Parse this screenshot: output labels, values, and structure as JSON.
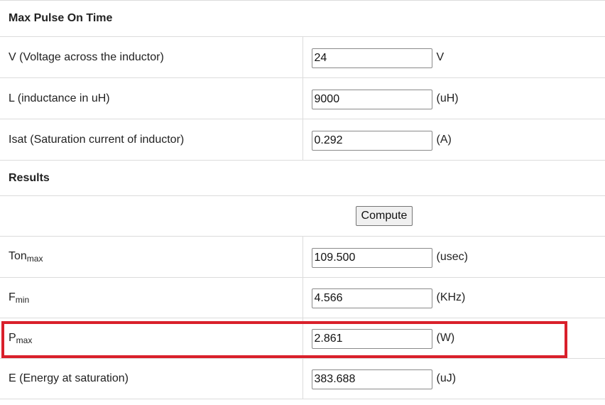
{
  "section_title": "Max Pulse On Time",
  "inputs": [
    {
      "label": "V (Voltage across the inductor)",
      "value": "24",
      "unit": "V"
    },
    {
      "label": "L (inductance in uH)",
      "value": "9000",
      "unit": "(uH)"
    },
    {
      "label": "Isat (Saturation current of inductor)",
      "value": "0.292",
      "unit": "(A)"
    }
  ],
  "results_title": "Results",
  "compute_label": "Compute",
  "results": [
    {
      "label_main": "Ton",
      "label_sub": "max",
      "value": "109.500",
      "unit": "(usec)"
    },
    {
      "label_main": "F",
      "label_sub": "min",
      "value": "4.566",
      "unit": "(KHz)"
    },
    {
      "label_main": "P",
      "label_sub": "max",
      "value": "2.861",
      "unit": "(W)"
    },
    {
      "label_main": "E (Energy at saturation)",
      "label_sub": "",
      "value": "383.688",
      "unit": "(uJ)"
    }
  ],
  "highlight_color": "#d9202b"
}
